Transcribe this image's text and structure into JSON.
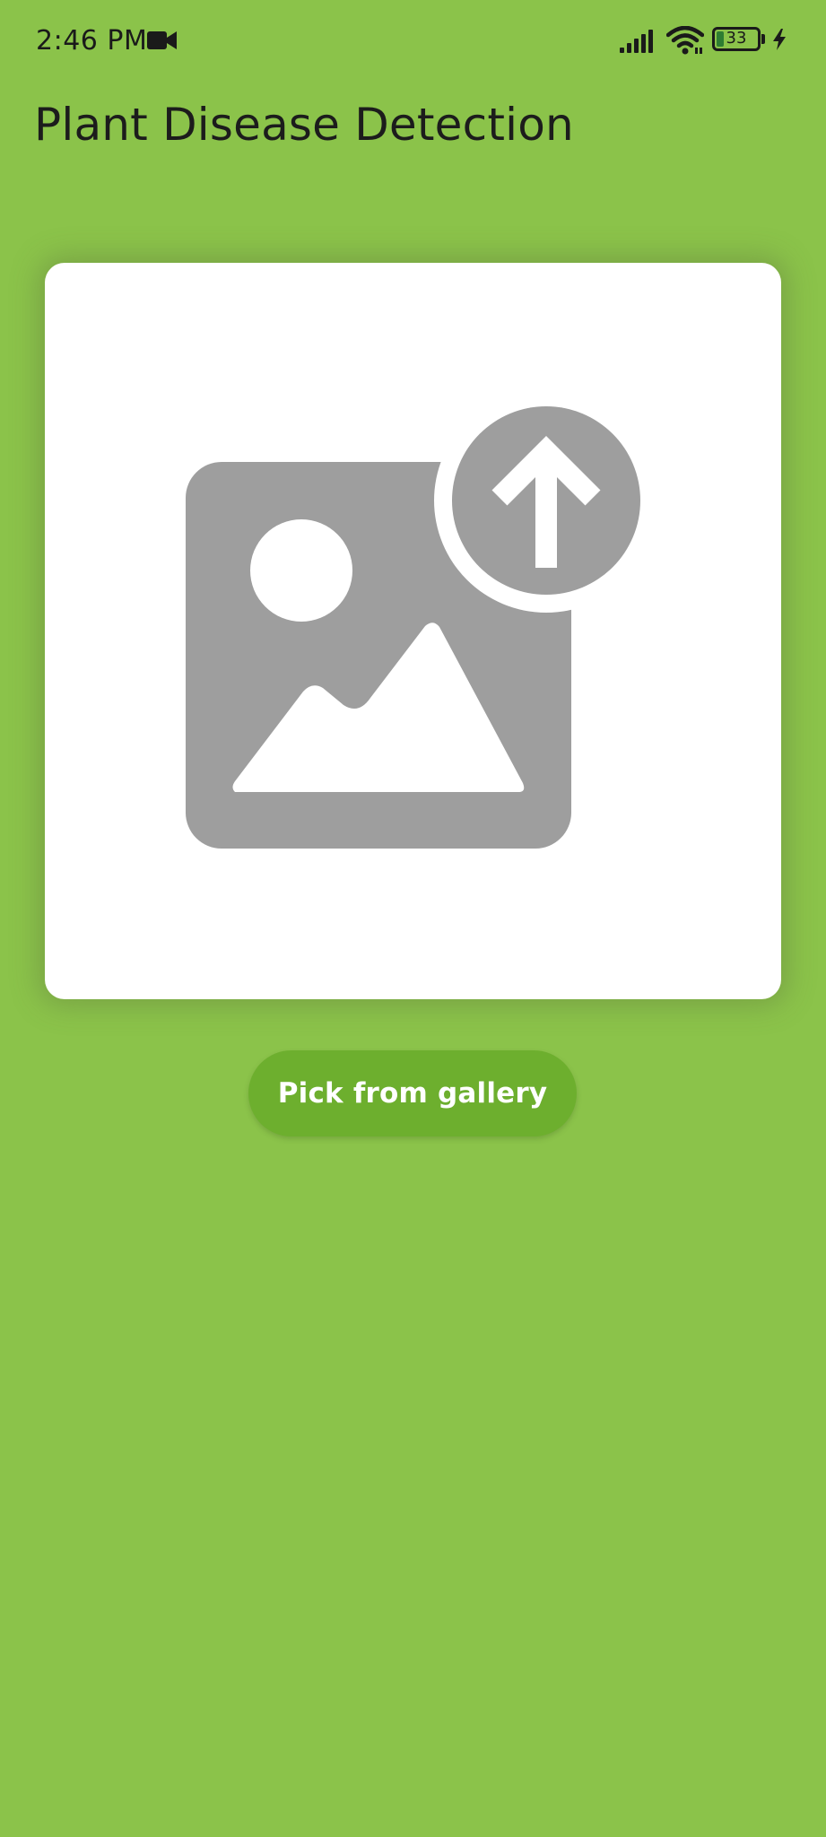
{
  "status_bar": {
    "time": "2:46 PM",
    "battery_level": "33",
    "icons": [
      "video-camera-icon",
      "signal-icon",
      "wifi-icon",
      "battery-icon",
      "charging-bolt-icon"
    ]
  },
  "app_bar": {
    "title": "Plant Disease Detection"
  },
  "image_card": {
    "icon": "image-upload-icon"
  },
  "actions": {
    "pick_label": "Pick from gallery"
  },
  "colors": {
    "background": "#8BC34A",
    "card": "#FFFFFF",
    "icon": "#9E9E9E",
    "button": "#6DAF2E",
    "button_text": "#FFFFFF"
  }
}
